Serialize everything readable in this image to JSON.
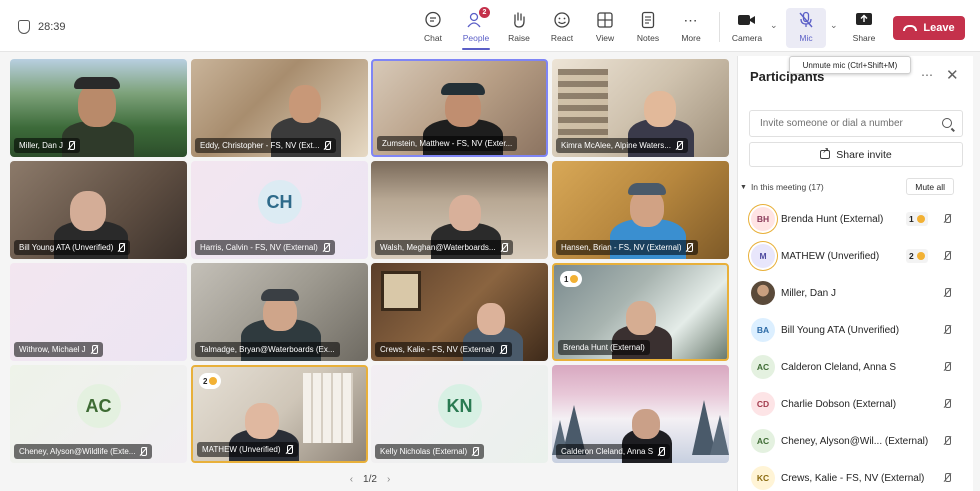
{
  "timer": "28:39",
  "toolbar": {
    "chat": "Chat",
    "people": "People",
    "people_badge": "2",
    "raise": "Raise",
    "react": "React",
    "view": "View",
    "notes": "Notes",
    "more": "More",
    "camera": "Camera",
    "mic": "Mic",
    "share": "Share",
    "leave": "Leave"
  },
  "tooltip": "Unmute mic (Ctrl+Shift+M)",
  "tiles": [
    {
      "label": "Miller, Dan J"
    },
    {
      "label": "Eddy, Christopher - FS, NV (Ext..."
    },
    {
      "label": "Zumstein, Matthew - FS, NV (Exter..."
    },
    {
      "label": "Kimra McAlee, Alpine Waters..."
    },
    {
      "label": "Bill Young ATA (Unverified)"
    },
    {
      "label": "Harris, Calvin - FS, NV (External)",
      "initials": "CH"
    },
    {
      "label": "Walsh, Meghan@Waterboards..."
    },
    {
      "label": "Hansen, Brian - FS, NV (External)"
    },
    {
      "label": "Withrow, Michael J"
    },
    {
      "label": "Talmadge, Bryan@Waterboards (Ex..."
    },
    {
      "label": "Crews, Kalie - FS, NV (External)"
    },
    {
      "label": "Brenda Hunt (External)",
      "hand": "1"
    },
    {
      "label": "Cheney, Alyson@Wildlife (Exte...",
      "initials": "AC"
    },
    {
      "label": "MATHEW (Unverified)",
      "hand": "2"
    },
    {
      "label": "Kelly Nicholas (External)",
      "initials": "KN"
    },
    {
      "label": "Calderon Cleland, Anna S"
    }
  ],
  "pager": "1/2",
  "panel": {
    "title": "Participants",
    "invite_placeholder": "Invite someone or dial a number",
    "share_invite": "Share invite",
    "section": "In this meeting (17)",
    "mute_all": "Mute all",
    "participants": [
      {
        "initials": "BH",
        "name": "Brenda Hunt (External)",
        "hand": "1",
        "color": "#ffe4e4",
        "fg": "#8a3a5a"
      },
      {
        "initials": "M",
        "name": "MATHEW (Unverified)",
        "hand": "2",
        "color": "#e8e6fb",
        "fg": "#4f4aa0"
      },
      {
        "initials": "",
        "name": "Miller, Dan J",
        "color": "#6b5a48",
        "fg": "#ffffff"
      },
      {
        "initials": "BA",
        "name": "Bill Young ATA (Unverified)",
        "color": "#dcefff",
        "fg": "#2b6aa6"
      },
      {
        "initials": "AC",
        "name": "Calderon Cleland, Anna S",
        "color": "#e4f1e0",
        "fg": "#3e6b34"
      },
      {
        "initials": "CD",
        "name": "Charlie Dobson (External)",
        "color": "#fde4e6",
        "fg": "#a23b4d"
      },
      {
        "initials": "AC",
        "name": "Cheney, Alyson@Wil... (External)",
        "color": "#e4f1e0",
        "fg": "#3e6b34"
      },
      {
        "initials": "KC",
        "name": "Crews, Kalie - FS, NV (External)",
        "color": "#fff4d6",
        "fg": "#8a6a10"
      }
    ]
  },
  "colors": {
    "accent": "#5b5fc7",
    "leave": "#c4314b",
    "hand_ring": "#e8b03a"
  }
}
